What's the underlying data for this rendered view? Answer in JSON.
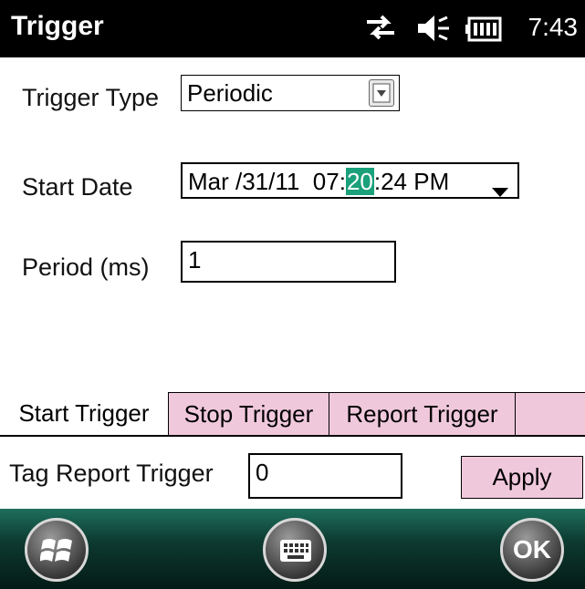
{
  "titlebar": {
    "title": "Trigger",
    "clock": "7:43",
    "icons": [
      "connectivity-icon",
      "volume-muted-icon",
      "battery-icon"
    ]
  },
  "form": {
    "trigger_type_label": "Trigger Type",
    "trigger_type_value": "Periodic",
    "start_date_label": "Start Date",
    "start_date": {
      "before": "Mar /31/11  07:",
      "selected": "20",
      "after": ":24 PM"
    },
    "period_label": "Period (ms)",
    "period_value": "1"
  },
  "tabs": [
    {
      "label": "Start Trigger",
      "active": true
    },
    {
      "label": "Stop Trigger",
      "active": false
    },
    {
      "label": "Report Trigger",
      "active": false
    },
    {
      "label": "",
      "active": false
    }
  ],
  "report": {
    "label": "Tag Report Trigger",
    "value": "0",
    "apply_label": "Apply"
  },
  "softkeys": {
    "ok_label": "OK"
  },
  "colors": {
    "tab_inactive": "#f0c8dc",
    "selection": "#1aa07a",
    "bottom_bar": "#0d3b31"
  }
}
